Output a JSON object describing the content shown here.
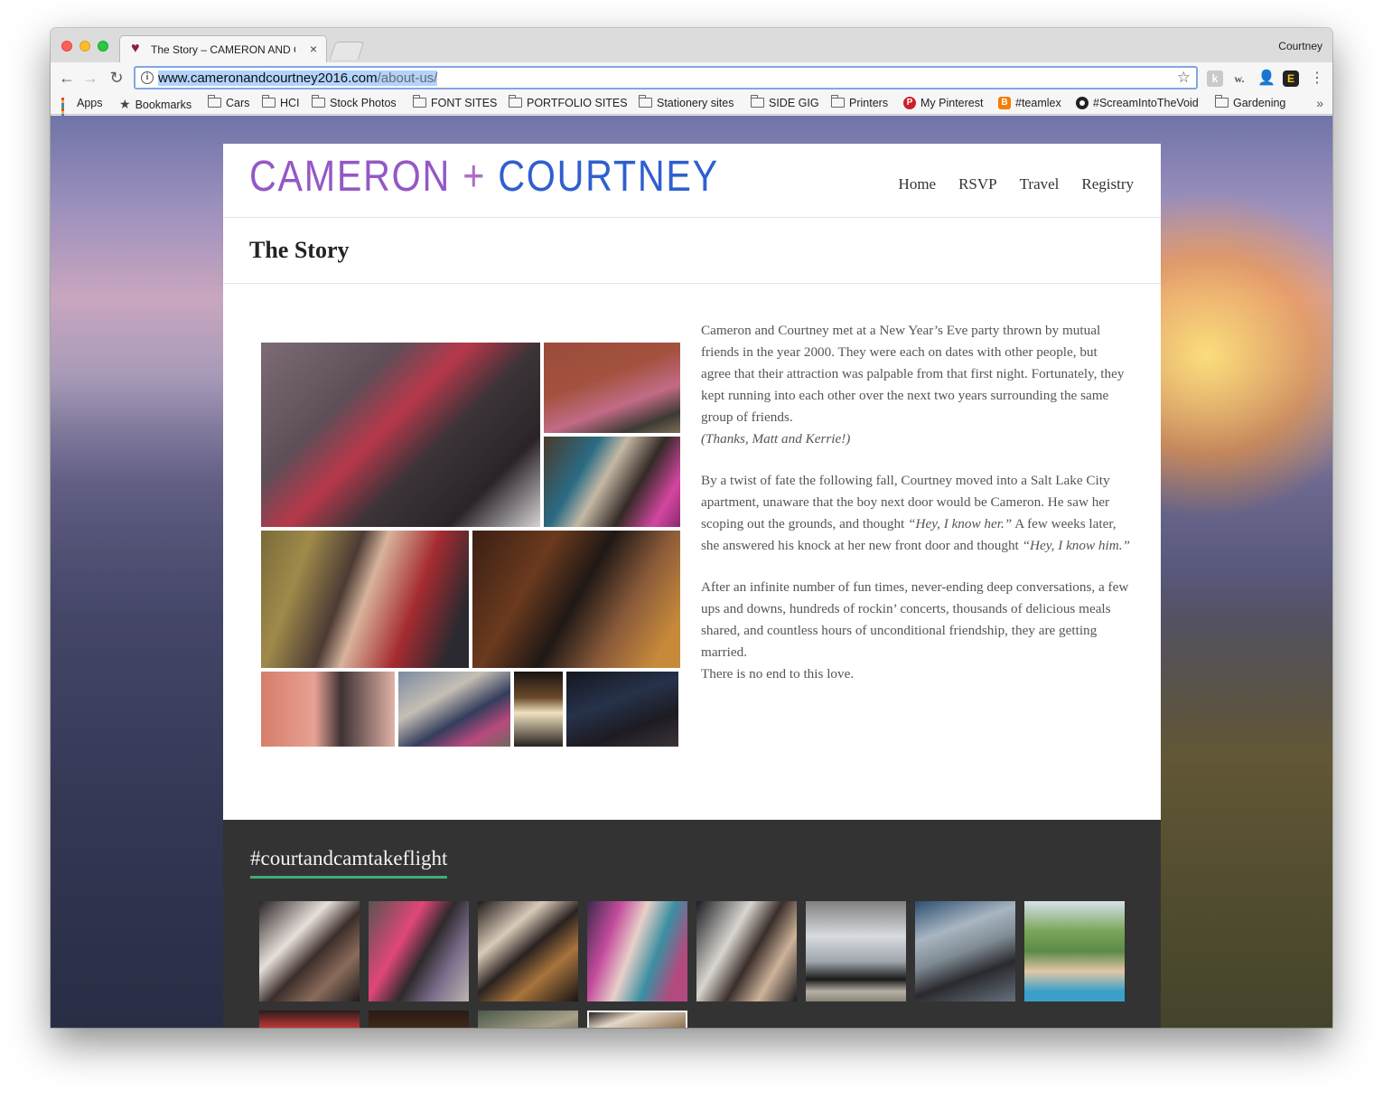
{
  "browser": {
    "tab_title": "The Story – CAMERON AND C",
    "tab_close": "×",
    "profile": "Courtney",
    "url_host": "www.cameronandcourtney2016.com",
    "url_path": "/about-us/",
    "info_icon": "i",
    "nav_back": "←",
    "nav_forward": "→",
    "nav_reload": "↻",
    "star": "☆",
    "menu": "⋮",
    "ext_labels": [
      "k",
      "w.",
      "👤",
      "E"
    ],
    "bookmarks": {
      "apps": "Apps",
      "bookmarks": "Bookmarks",
      "folders": [
        "Cars",
        "HCI",
        "Stock Photos",
        "FONT SITES",
        "PORTFOLIO SITES",
        "Stationery sites",
        "SIDE GIG",
        "Printers"
      ],
      "pinterest": "My Pinterest",
      "teamlex": "#teamlex",
      "scream": "#ScreamIntoTheVoid",
      "gardening": "Gardening",
      "more": "»"
    }
  },
  "site": {
    "logo_name1": "CAMERON",
    "logo_plus": " + ",
    "logo_name2": "COURTNEY",
    "nav": [
      "Home",
      "RSVP",
      "Travel",
      "Registry"
    ],
    "page_title": "The Story",
    "story": {
      "p1": "Cameron and Courtney met at a New Year’s Eve party thrown by mutual friends in the year 2000. They were each on dates with other people, but agree that their attraction was palpable from that first night. Fortunately, they kept running into each other over the next two years surrounding the same group of friends.",
      "p1_thanks": "(Thanks, Matt and Kerrie!)",
      "p2_a": "By a twist of fate the following fall, Courtney moved into a Salt Lake City apartment, unaware that the boy next door would be Cameron. He saw her scoping out the grounds, and thought ",
      "p2_q1": "“Hey, I know her.”",
      "p2_b": " A few weeks later, she answered his knock at her new front door and thought ",
      "p2_q2": "“Hey, I know him.”",
      "p3": "After an infinite number of fun times, never-ending deep conversations, a few ups and downs, hundreds of rockin’ concerts, thousands of delicious meals shared, and countless hours of unconditional friendship, they are getting married.",
      "p3_end": "There is no end to this love."
    },
    "hashtag": "#courtandcamtakeflight"
  },
  "colors": {
    "logo_purple": "#9458c6",
    "logo_blue": "#2f5fcf",
    "footer_bg": "#333333",
    "hashtag_underline": "#3fae73",
    "url_selection": "#b3d3fb"
  }
}
